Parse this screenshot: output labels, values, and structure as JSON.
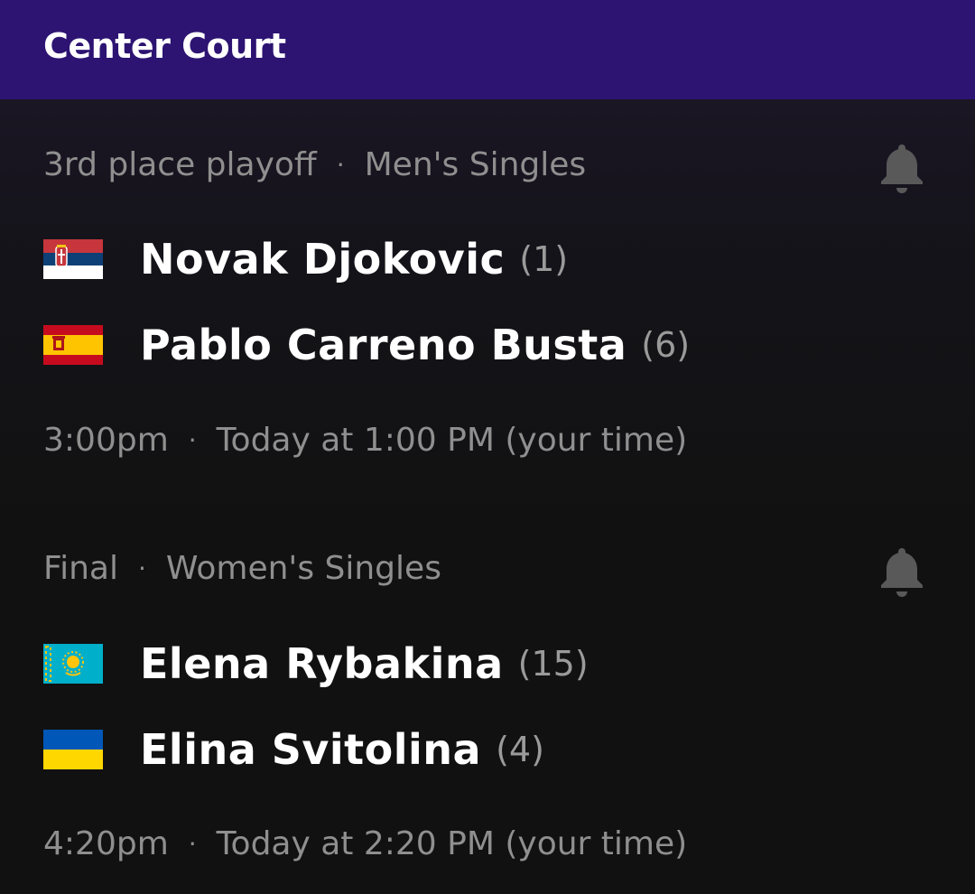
{
  "header": {
    "title": "Center Court"
  },
  "separator": "·",
  "matches": [
    {
      "round": "3rd place playoff",
      "event": "Men's Singles",
      "players": [
        {
          "name": "Novak Djokovic",
          "seed": "(1)",
          "flag_icon": "serbia-flag-icon",
          "flag_colors": [
            "#c6363c",
            "#0c4076",
            "#ffffff"
          ]
        },
        {
          "name": "Pablo Carreno Busta",
          "seed": "(6)",
          "flag_icon": "spain-flag-icon",
          "flag_colors": [
            "#c60b1e",
            "#ffc400",
            "#c60b1e"
          ]
        }
      ],
      "local_time": "3:00pm",
      "your_time": "Today at 1:00 PM (your time)"
    },
    {
      "round": "Final",
      "event": "Women's Singles",
      "players": [
        {
          "name": "Elena Rybakina",
          "seed": "(15)",
          "flag_icon": "kazakhstan-flag-icon",
          "flag_colors": [
            "#00afca",
            "#fec50c"
          ]
        },
        {
          "name": "Elina Svitolina",
          "seed": "(4)",
          "flag_icon": "ukraine-flag-icon",
          "flag_colors": [
            "#0057b7",
            "#ffd700"
          ]
        }
      ],
      "local_time": "4:20pm",
      "your_time": "Today at 2:20 PM (your time)"
    }
  ],
  "colors": {
    "header_bg": "#2d1472",
    "bg": "#121212",
    "muted_text": "#8f8f8f",
    "bell": "#595959"
  }
}
